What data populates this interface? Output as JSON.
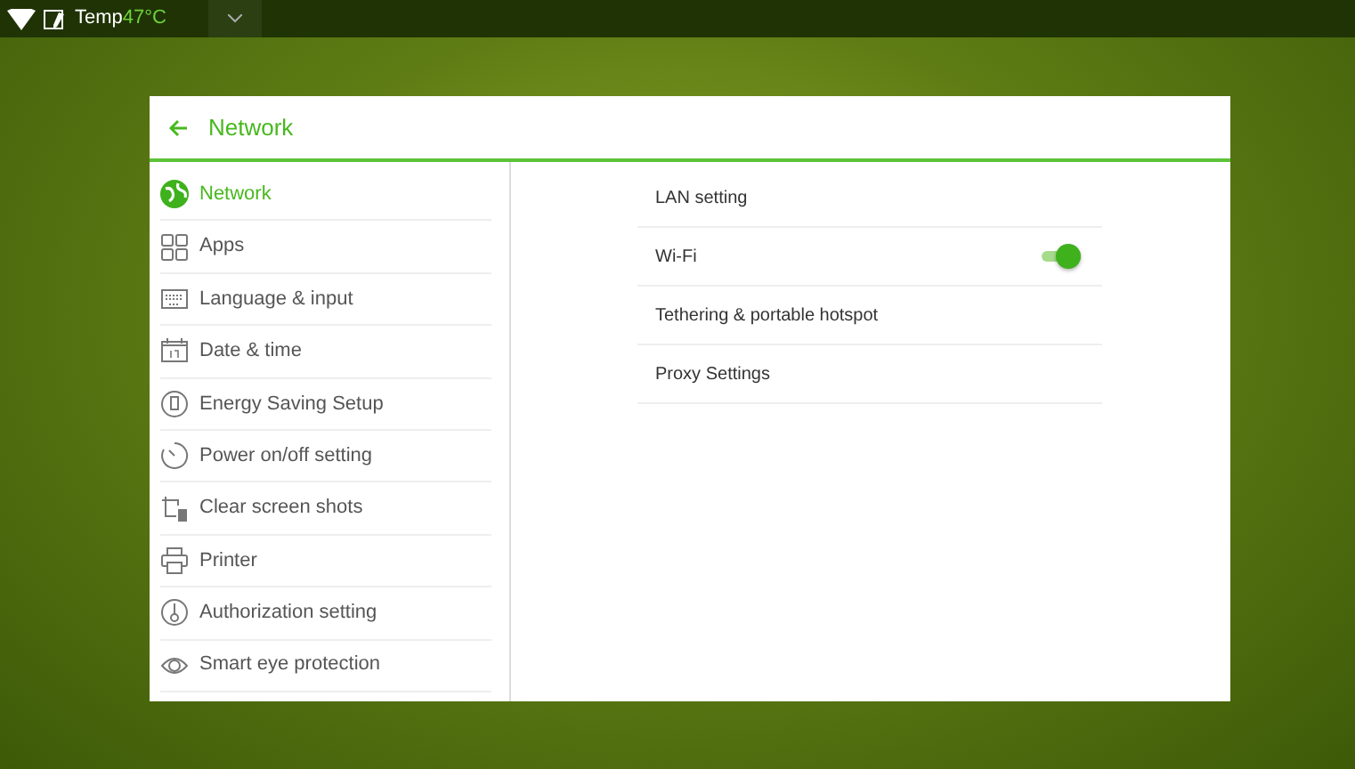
{
  "status_bar": {
    "temp_label": "Temp",
    "temp_value": "47°C"
  },
  "header": {
    "title": "Network"
  },
  "sidebar": {
    "items": [
      {
        "label": "Network",
        "selected": true
      },
      {
        "label": "Apps",
        "selected": false
      },
      {
        "label": "Language & input",
        "selected": false
      },
      {
        "label": "Date & time",
        "selected": false
      },
      {
        "label": "Energy Saving Setup",
        "selected": false
      },
      {
        "label": "Power on/off setting",
        "selected": false
      },
      {
        "label": "Clear screen shots",
        "selected": false
      },
      {
        "label": "Printer",
        "selected": false
      },
      {
        "label": "Authorization setting",
        "selected": false
      },
      {
        "label": "Smart eye protection",
        "selected": false
      }
    ]
  },
  "settings": [
    {
      "kind": "link",
      "label": "LAN setting"
    },
    {
      "kind": "toggle",
      "label": "Wi-Fi",
      "on": true
    },
    {
      "kind": "link",
      "label": "Tethering & portable hotspot"
    },
    {
      "kind": "link",
      "label": "Proxy Settings"
    }
  ]
}
